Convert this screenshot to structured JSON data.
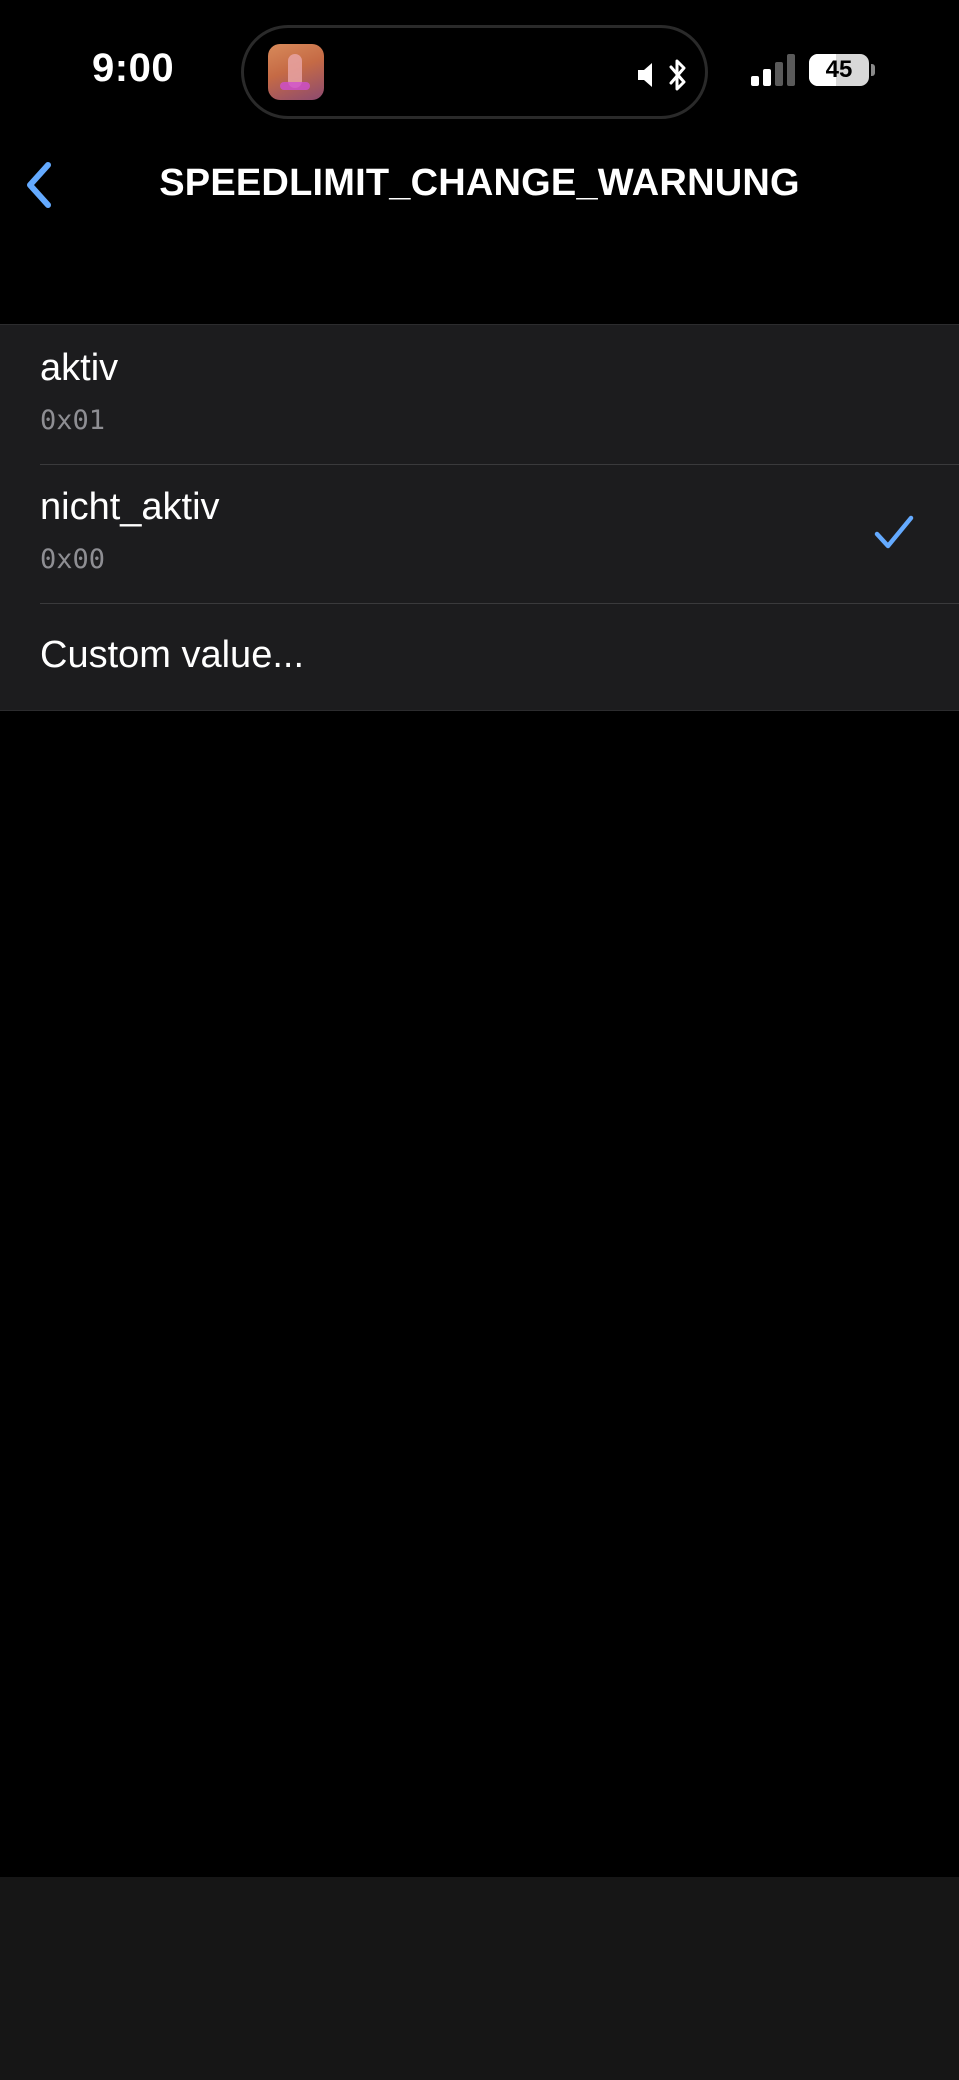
{
  "status_bar": {
    "time": "9:00",
    "battery_level": "45",
    "battery_fraction": 0.45,
    "icons": [
      "app-icon",
      "mute-icon",
      "bluetooth-icon",
      "signal-icon",
      "battery-icon"
    ]
  },
  "nav": {
    "title": "SPEEDLIMIT_CHANGE_WARNUNG",
    "back_icon": "chevron-left-icon"
  },
  "options": [
    {
      "label": "aktiv",
      "code": "0x01",
      "selected": false
    },
    {
      "label": "nicht_aktiv",
      "code": "0x00",
      "selected": true
    },
    {
      "label": "Custom value...",
      "code": "",
      "selected": false
    }
  ],
  "colors": {
    "accent": "#64aaff",
    "background": "#000000",
    "list_background": "#1c1c1e",
    "secondary_text": "#8e8e93"
  }
}
